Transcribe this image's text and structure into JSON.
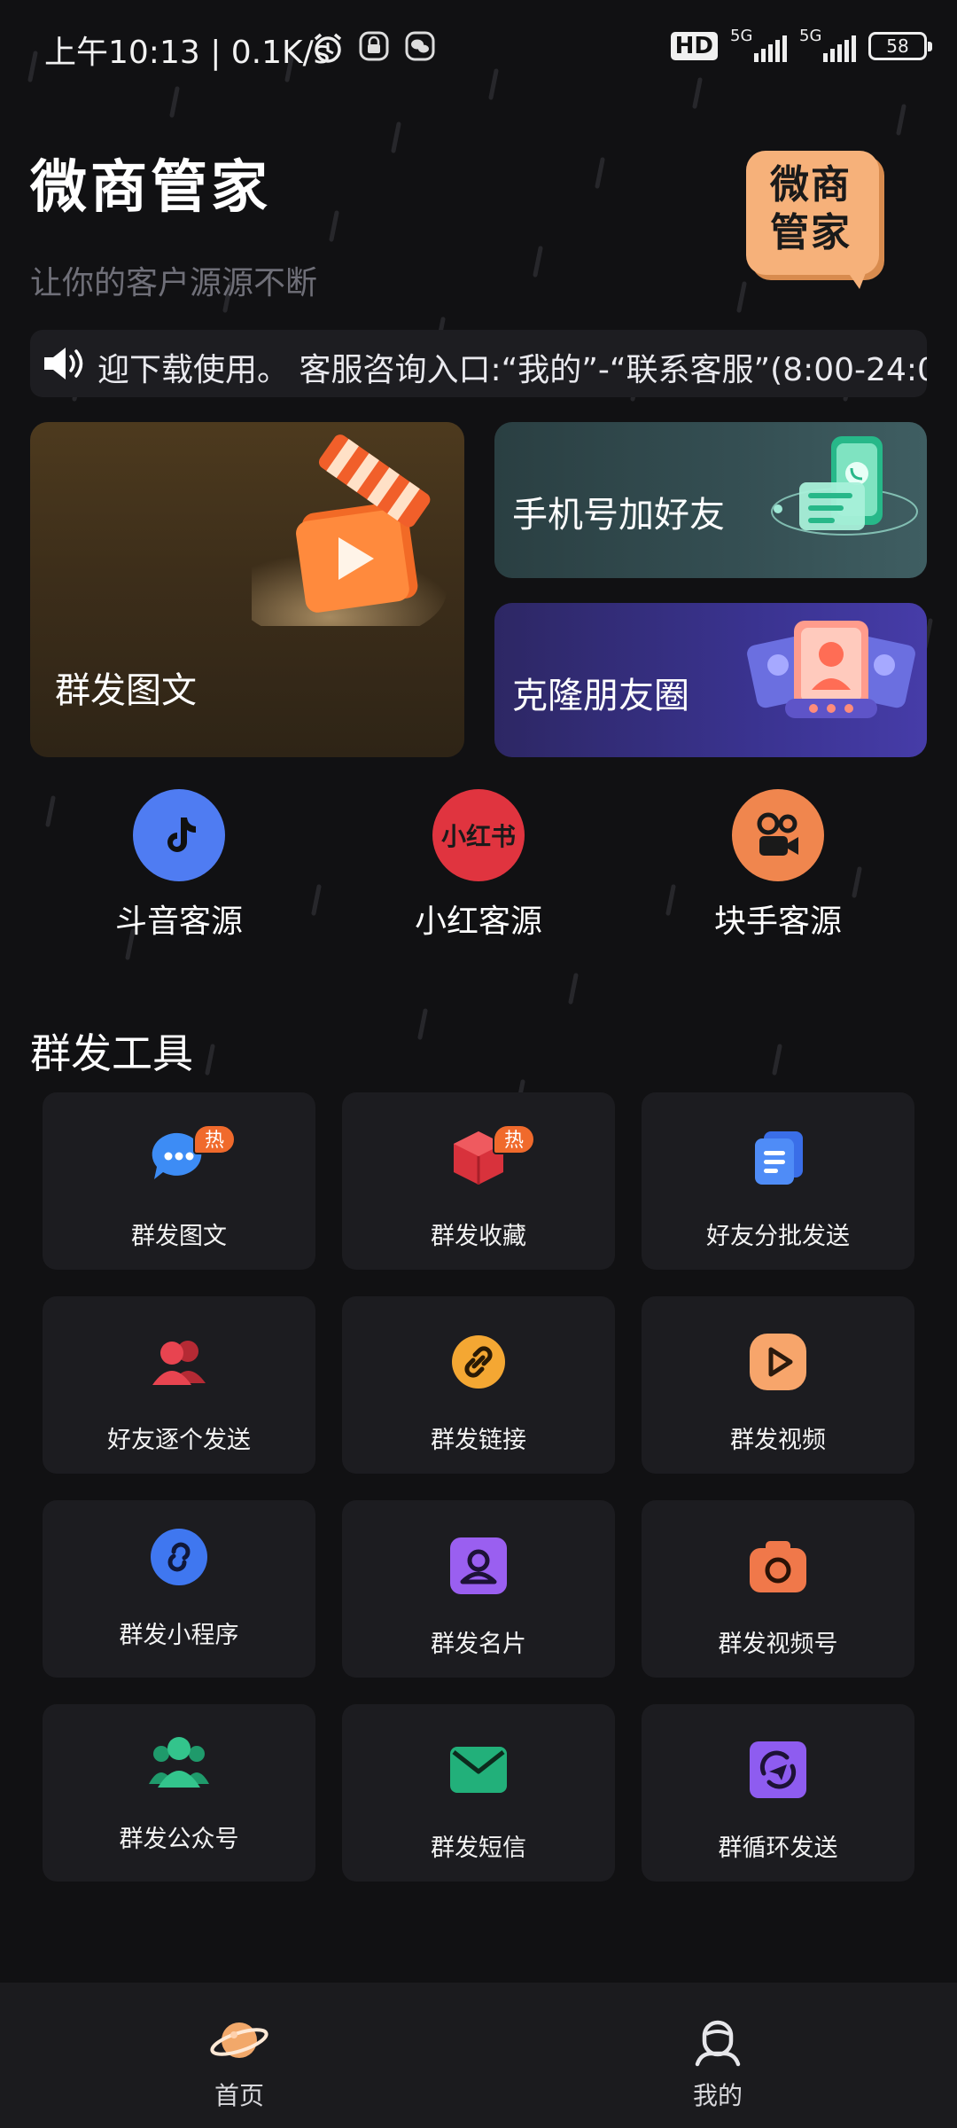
{
  "status_bar": {
    "time": "上午10:13 | 0.1K/s",
    "hd_label": "HD",
    "signal1_label": "5G",
    "signal2_label": "5G",
    "battery": "58"
  },
  "header": {
    "title": "微商管家",
    "subtitle": "让你的客户源源不断",
    "logo_text": "微商管家"
  },
  "notice": {
    "text": "迎下载使用。 客服咨询入口:“我的”-“联系客服”(8:00-24:0"
  },
  "feature_cards": [
    {
      "label": "群发图文"
    },
    {
      "label": "手机号加好友"
    },
    {
      "label": "克隆朋友圈"
    }
  ],
  "sources": [
    {
      "label": "斗音客源",
      "color": "#4f7cf2",
      "icon": "douyin-icon"
    },
    {
      "label": "小红客源",
      "color": "#e0343f",
      "icon": "xiaohongshu-icon",
      "icon_text": "小红书"
    },
    {
      "label": "块手客源",
      "color": "#f0864e",
      "icon": "kuaishou-icon"
    }
  ],
  "tools_section": {
    "title": "群发工具",
    "hot_badge": "热",
    "items": [
      {
        "label": "群发图文",
        "icon": "chat-bubble-icon",
        "hot": true
      },
      {
        "label": "群发收藏",
        "icon": "cube-icon",
        "hot": true
      },
      {
        "label": "好友分批发送",
        "icon": "document-stack-icon",
        "hot": false
      },
      {
        "label": "好友逐个发送",
        "icon": "users-icon",
        "hot": false
      },
      {
        "label": "群发链接",
        "icon": "link-icon",
        "hot": false
      },
      {
        "label": "群发视频",
        "icon": "video-play-icon",
        "hot": false
      },
      {
        "label": "群发小程序",
        "icon": "mini-program-icon",
        "hot": false
      },
      {
        "label": "群发名片",
        "icon": "contact-card-icon",
        "hot": false
      },
      {
        "label": "群发视频号",
        "icon": "camera-icon",
        "hot": false
      },
      {
        "label": "群发公众号",
        "icon": "group-icon",
        "hot": false
      },
      {
        "label": "群发短信",
        "icon": "envelope-icon",
        "hot": false
      },
      {
        "label": "群循环发送",
        "icon": "loop-send-icon",
        "hot": false
      }
    ]
  },
  "bottom_nav": {
    "home_label": "首页",
    "mine_label": "我的"
  }
}
